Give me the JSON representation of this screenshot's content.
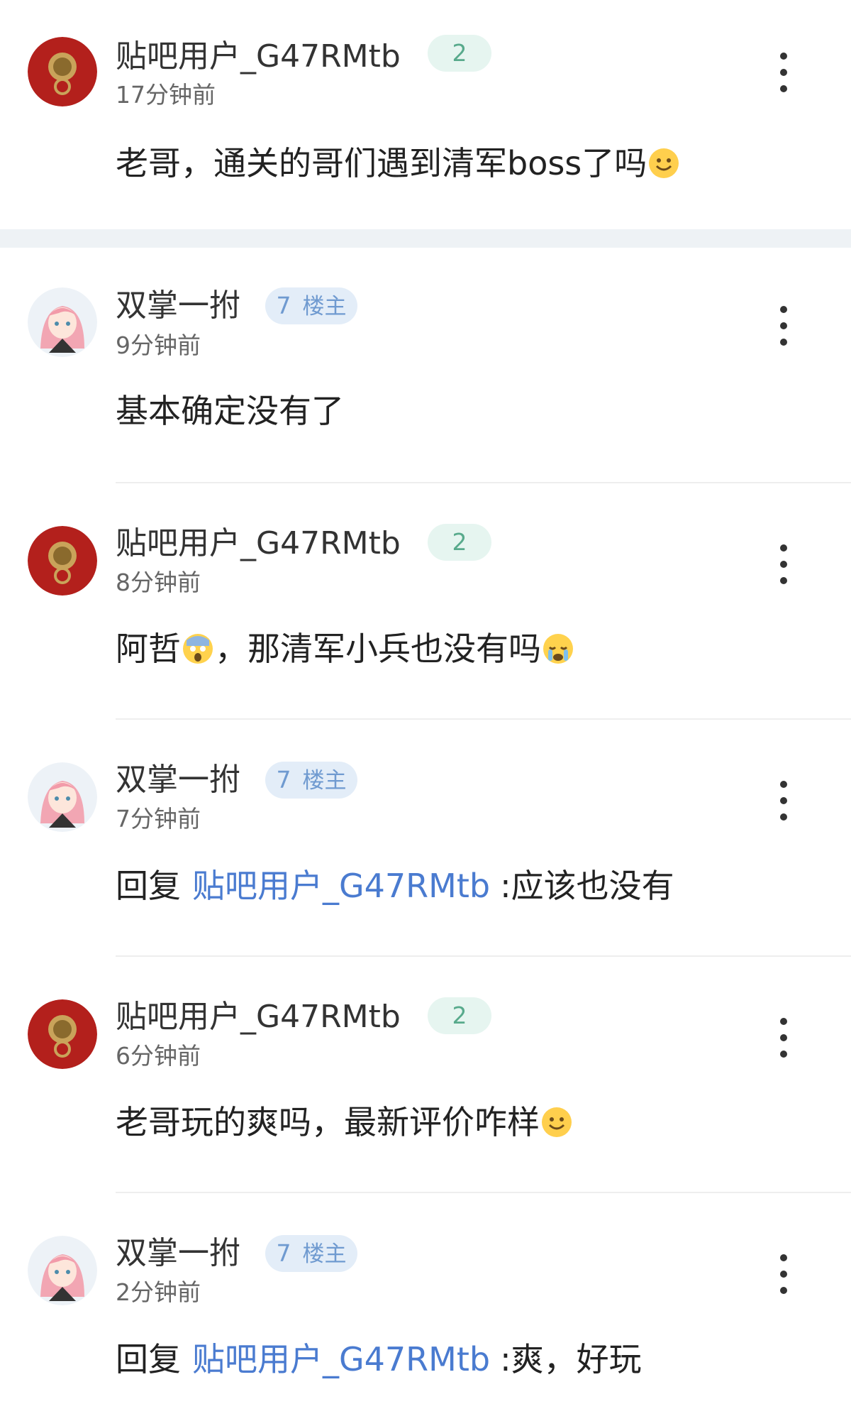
{
  "comments": [
    {
      "user": "贴吧用户_G47RMtb",
      "level": "2",
      "time": "17分钟前",
      "text": "老哥，通关的哥们遇到清军boss了吗"
    },
    {
      "user": "双掌一拊",
      "level": "7",
      "tag": "楼主",
      "time": "9分钟前",
      "text": "基本确定没有了"
    },
    {
      "user": "贴吧用户_G47RMtb",
      "level": "2",
      "time": "8分钟前",
      "text_a": "阿哲",
      "text_b": "，那清军小兵也没有吗"
    },
    {
      "user": "双掌一拊",
      "level": "7",
      "tag": "楼主",
      "time": "7分钟前",
      "reply_prefix": "回复",
      "reply_to": "贴吧用户_G47RMtb",
      "text": ":应该也没有"
    },
    {
      "user": "贴吧用户_G47RMtb",
      "level": "2",
      "time": "6分钟前",
      "text": "老哥玩的爽吗，最新评价咋样"
    },
    {
      "user": "双掌一拊",
      "level": "7",
      "tag": "楼主",
      "time": "2分钟前",
      "reply_prefix": "回复",
      "reply_to": "贴吧用户_G47RMtb",
      "text": ":爽，好玩"
    }
  ],
  "emojis": {
    "smile": "smile-emoji",
    "scared": "scared-emoji",
    "crying": "crying-emoji"
  },
  "colors": {
    "link": "#4a7bd0",
    "badge_green": "#58aa8c",
    "badge_blue": "#6f9ad0"
  }
}
